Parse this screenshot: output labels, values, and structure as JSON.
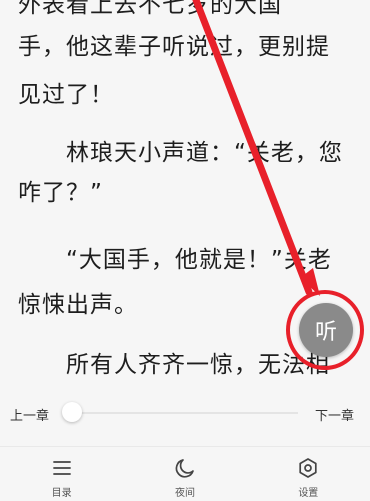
{
  "reader": {
    "lines": [
      "外表看上去不七岁的大国",
      "手，他这辈子听说过，更别提",
      "见过了！",
      "林琅天小声道：“关老，您",
      "咋了？”",
      "“大国手，他就是！”关老",
      "惊悚出声。",
      "所有人齐齐一惊，无法相"
    ],
    "listen_button_label": "听"
  },
  "chapter_bar": {
    "prev_label": "上一章",
    "next_label": "下一章",
    "progress": 0.0
  },
  "bottom_nav": {
    "items": [
      {
        "label": "目录",
        "icon": "menu-icon"
      },
      {
        "label": "夜间",
        "icon": "moon-icon"
      },
      {
        "label": "设置",
        "icon": "gear-icon"
      }
    ]
  },
  "colors": {
    "background": "#f6f6f6",
    "text": "#1e1e1e",
    "listen_button": "#8a8a8a",
    "annotation": "#e8202a"
  }
}
